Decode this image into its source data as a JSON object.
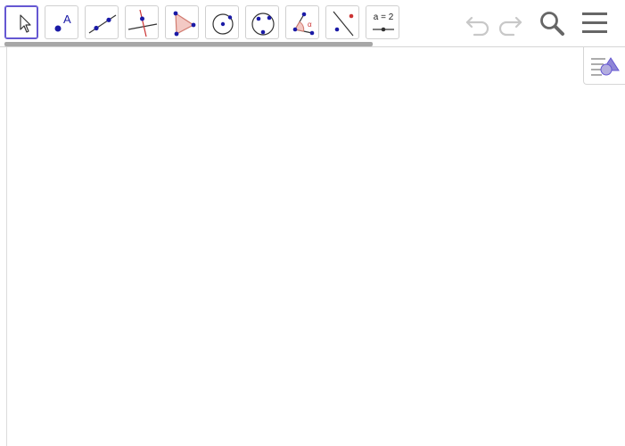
{
  "toolbar": {
    "tools": [
      {
        "name": "move-tool",
        "selected": true
      },
      {
        "name": "point-tool",
        "label": "A"
      },
      {
        "name": "line-tool"
      },
      {
        "name": "perpendicular-line-tool"
      },
      {
        "name": "polygon-tool"
      },
      {
        "name": "circle-center-point-tool"
      },
      {
        "name": "circle-three-points-tool"
      },
      {
        "name": "angle-tool"
      },
      {
        "name": "reflect-tool"
      },
      {
        "name": "slider-tool",
        "label": "a = 2"
      }
    ],
    "undo_icon": "undo-icon",
    "redo_icon": "redo-icon",
    "search_icon": "search-icon",
    "menu_icon": "menu-icon"
  },
  "colors": {
    "accent": "#6557d2",
    "point": "#1a1aa6",
    "polygon_fill": "#f3c9c4",
    "polygon_stroke": "#d17b70",
    "icon_gray": "#666666",
    "disabled_gray": "#c8c8c8"
  }
}
